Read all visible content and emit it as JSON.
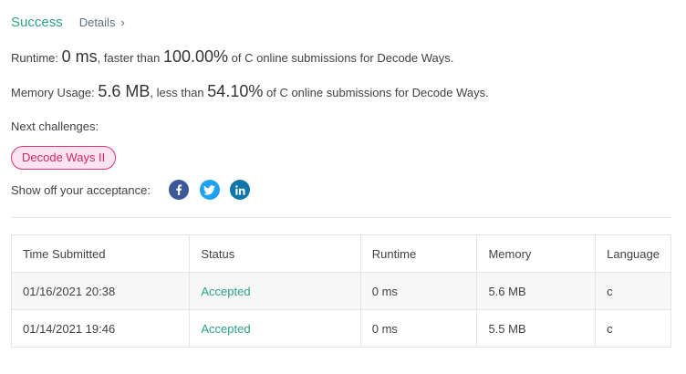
{
  "header": {
    "status_text": "Success",
    "details_label": "Details",
    "details_chevron": "›",
    "colors": {
      "success": "#2aa388",
      "pill_border": "#e0337a",
      "pill_text": "#d1256b"
    }
  },
  "runtime": {
    "label": "Runtime:",
    "value": "0 ms",
    "comparison": ", faster than",
    "percent": "100.00%",
    "suffix": "of C online submissions for Decode Ways."
  },
  "memory": {
    "label": "Memory Usage:",
    "value": "5.6 MB",
    "comparison": ", less than",
    "percent": "54.10%",
    "suffix": "of C online submissions for Decode Ways."
  },
  "next_challenges": {
    "label": "Next challenges:",
    "items": [
      "Decode Ways II"
    ]
  },
  "share": {
    "label": "Show off your acceptance:",
    "icons": [
      {
        "name": "facebook-icon",
        "color": "#3b5998"
      },
      {
        "name": "twitter-icon",
        "color": "#1da1f2"
      },
      {
        "name": "linkedin-icon",
        "color": "#0e76a8"
      }
    ]
  },
  "submissions": {
    "columns": [
      "Time Submitted",
      "Status",
      "Runtime",
      "Memory",
      "Language"
    ],
    "rows": [
      {
        "time": "01/16/2021 20:38",
        "status": "Accepted",
        "runtime": "0 ms",
        "memory": "5.6 MB",
        "language": "c"
      },
      {
        "time": "01/14/2021 19:46",
        "status": "Accepted",
        "runtime": "0 ms",
        "memory": "5.5 MB",
        "language": "c"
      }
    ]
  }
}
